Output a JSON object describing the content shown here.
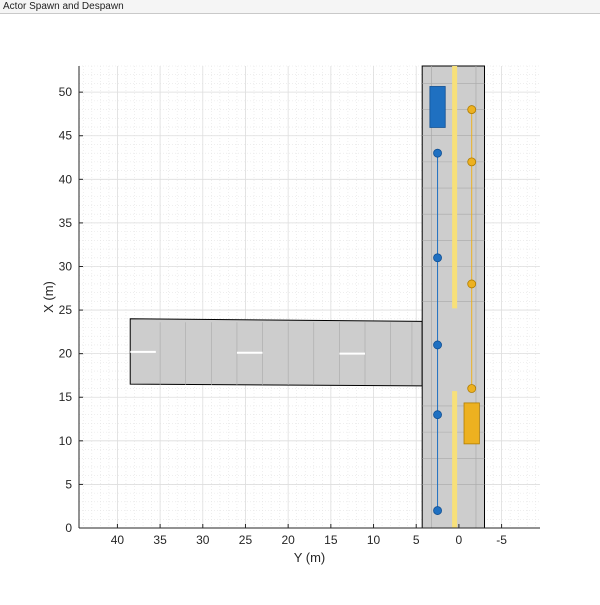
{
  "window": {
    "title": "Actor Spawn and Despawn"
  },
  "axes": {
    "xlabel": "Y (m)",
    "ylabel": "X (m)",
    "y_range": [
      44.5,
      -9.5
    ],
    "x_range": [
      0,
      53
    ],
    "y_ticks": [
      40,
      35,
      30,
      25,
      20,
      15,
      10,
      5,
      0,
      -5
    ],
    "x_ticks": [
      0,
      5,
      10,
      15,
      20,
      25,
      30,
      35,
      40,
      45,
      50
    ],
    "y_tick_labels": [
      "40",
      "35",
      "30",
      "25",
      "20",
      "15",
      "10",
      "5",
      "0",
      "-5"
    ],
    "x_tick_labels": [
      "0",
      "5",
      "10",
      "15",
      "20",
      "25",
      "30",
      "35",
      "40",
      "45",
      "50"
    ],
    "grid": true,
    "background": "#ffffff"
  },
  "colors": {
    "road": "#cdcdcd",
    "road_edge": "#000000",
    "lane_line": "#a9a9a9",
    "center_line": "#f7e07a",
    "dash_marking": "#ffffff",
    "blue_actor": "#1f70c1",
    "blue_actor_dark": "#0f4f93",
    "yellow_actor": "#edb120",
    "yellow_actor_dark": "#b07d00"
  },
  "scene": {
    "main_road": {
      "y_min": -3.0,
      "y_max": 4.3,
      "x_min": 0,
      "x_max": 53
    },
    "side_road": {
      "y_from": 4.3,
      "y_to": 38.5,
      "x_lo_near": 16.3,
      "x_hi_near": 23.7,
      "x_lo_far": 16.5,
      "x_hi_far": 24.0
    },
    "center_line": {
      "y": 0.5,
      "x_segments": [
        [
          0,
          15.7
        ],
        [
          25.2,
          53
        ]
      ]
    },
    "lane_dividers_y": [
      3.2,
      -2.0
    ],
    "transverse_lines_x": [
      5,
      8,
      11,
      14,
      26,
      30,
      33,
      36,
      39,
      42,
      45,
      48,
      51
    ],
    "side_road_dashes": [
      {
        "y_from": 38.5,
        "y_to": 35.5,
        "x": 20.2
      },
      {
        "y_from": 26.0,
        "y_to": 23.0,
        "x": 20.1
      },
      {
        "y_from": 14.0,
        "y_to": 11.0,
        "x": 20.0
      }
    ],
    "side_road_cross_lines_y": [
      35,
      32,
      29,
      26,
      23,
      20,
      17,
      14,
      11,
      8,
      5.5
    ]
  },
  "actors": [
    {
      "name": "blue-vehicle",
      "color_key": "blue_actor",
      "vehicle": {
        "y_center": 2.5,
        "x_center": 48.3,
        "width": 1.8,
        "length": 4.7
      },
      "path_y": 2.5,
      "waypoints_x": [
        2,
        13,
        21,
        31,
        43
      ]
    },
    {
      "name": "yellow-vehicle",
      "color_key": "yellow_actor",
      "vehicle": {
        "y_center": -1.5,
        "x_center": 12.0,
        "width": 1.8,
        "length": 4.7
      },
      "path_y": -1.5,
      "waypoints_x": [
        16,
        28,
        42,
        48
      ]
    }
  ]
}
